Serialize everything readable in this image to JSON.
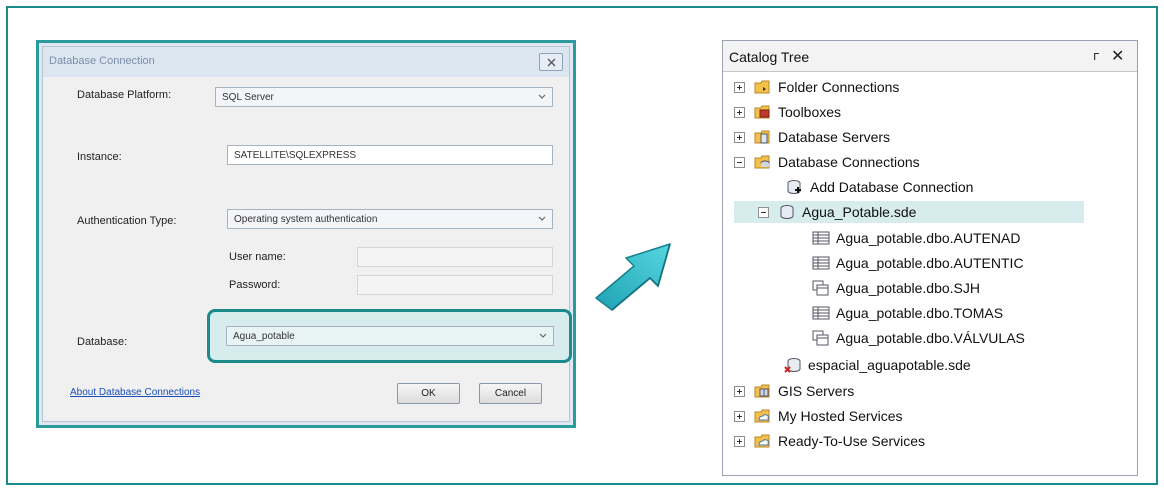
{
  "dialog": {
    "title": "Database Connection",
    "platform_label": "Database Platform:",
    "platform_value": "SQL Server",
    "instance_label": "Instance:",
    "instance_value": "SATELLITE\\SQLEXPRESS",
    "auth_label": "Authentication Type:",
    "auth_value": "Operating system authentication",
    "username_label": "User name:",
    "password_label": "Password:",
    "database_label": "Database:",
    "database_value": "Agua_potable",
    "about_link": "About Database Connections",
    "ok_label": "OK",
    "cancel_label": "Cancel"
  },
  "catalog": {
    "title": "Catalog Tree",
    "pin_icon": "pin-icon",
    "close_icon": "close-icon",
    "items": [
      {
        "label": "Folder Connections",
        "icon": "folder-connections-icon",
        "expander": "plus"
      },
      {
        "label": "Toolboxes",
        "icon": "toolbox-icon",
        "expander": "plus"
      },
      {
        "label": "Database Servers",
        "icon": "database-servers-icon",
        "expander": "plus"
      },
      {
        "label": "Database Connections",
        "icon": "database-connections-icon",
        "expander": "minus"
      },
      {
        "label": "Add Database Connection",
        "icon": "add-database-connection-icon",
        "expander": "none"
      },
      {
        "label": "Agua_Potable.sde",
        "icon": "database-icon",
        "expander": "minus"
      },
      {
        "label": "Agua_potable.dbo.AUTENAD",
        "icon": "table-icon",
        "expander": "none"
      },
      {
        "label": "Agua_potable.dbo.AUTENTIC",
        "icon": "table-icon",
        "expander": "none"
      },
      {
        "label": "Agua_potable.dbo.SJH",
        "icon": "feature-class-icon",
        "expander": "none"
      },
      {
        "label": "Agua_potable.dbo.TOMAS",
        "icon": "table-icon",
        "expander": "none"
      },
      {
        "label": "Agua_potable.dbo.VÁLVULAS",
        "icon": "feature-class-icon",
        "expander": "none"
      },
      {
        "label": "espacial_aguapotable.sde",
        "icon": "database-error-icon",
        "expander": "none"
      },
      {
        "label": "GIS Servers",
        "icon": "gis-servers-icon",
        "expander": "plus"
      },
      {
        "label": "My Hosted Services",
        "icon": "hosted-services-icon",
        "expander": "plus"
      },
      {
        "label": "Ready-To-Use Services",
        "icon": "ready-services-icon",
        "expander": "plus"
      }
    ]
  },
  "colors": {
    "accent": "#1a8a8a",
    "selection": "#d7ecec",
    "arrow": "#2fb8c8"
  }
}
